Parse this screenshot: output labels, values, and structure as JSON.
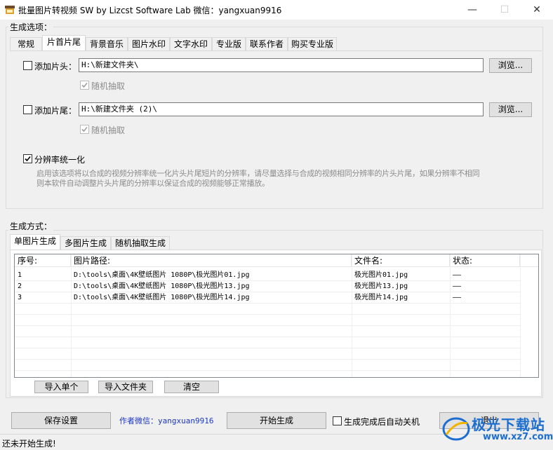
{
  "window": {
    "title": "批量图片转视频 SW  by Lizcst Software Lab  微信：yangxuan9916",
    "minimize": "—",
    "maximize": "☐",
    "close": "✕"
  },
  "options_group": {
    "legend": "生成选项：",
    "tabs": [
      "常规",
      "片首片尾",
      "背景音乐",
      "图片水印",
      "文字水印",
      "专业版",
      "联系作者",
      "购买专业版"
    ],
    "active_tab": 1,
    "head": {
      "label": "添加片头：",
      "path": "H:\\新建文件夹\\",
      "browse": "浏览...",
      "random_label": "随机抽取"
    },
    "tail": {
      "label": "添加片尾：",
      "path": "H:\\新建文件夹 (2)\\",
      "browse": "浏览...",
      "random_label": "随机抽取"
    },
    "unify": {
      "label": "分辨率统一化",
      "checked": true,
      "description_line1": "启用该选项将以合成的视频分辨率统一化片头片尾短片的分辨率，请尽量选择与合成的视频相同分辨率的片头片尾，如果分辨率不相同",
      "description_line2": "则本软件自动调整片头片尾的分辨率以保证合成的视频能够正常播放。"
    }
  },
  "mode_group": {
    "legend": "生成方式：",
    "tabs": [
      "单图片生成",
      "多图片生成",
      "随机抽取生成"
    ],
    "active_tab": 0,
    "columns": [
      "序号:",
      "图片路径:",
      "文件名:",
      "状态:"
    ],
    "rows": [
      {
        "index": "1",
        "path": "D:\\tools\\桌面\\4K壁纸图片 1080P\\极光图片01.jpg",
        "filename": "极光图片01.jpg",
        "status": "——"
      },
      {
        "index": "2",
        "path": "D:\\tools\\桌面\\4K壁纸图片 1080P\\极光图片13.jpg",
        "filename": "极光图片13.jpg",
        "status": "——"
      },
      {
        "index": "3",
        "path": "D:\\tools\\桌面\\4K壁纸图片 1080P\\极光图片14.jpg",
        "filename": "极光图片14.jpg",
        "status": "——"
      }
    ],
    "import_single": "导入单个",
    "import_folder": "导入文件夹",
    "clear": "清空"
  },
  "bottom": {
    "save_settings": "保存设置",
    "author_wechat": "作者微信：yangxuan9916",
    "start": "开始生成",
    "auto_shutdown": "生成完成后自动关机",
    "exit": "退出",
    "status": "还未开始生成!"
  },
  "watermark": {
    "brand": "极光下载站",
    "url": "www.xz7.com"
  },
  "colors": {
    "author_link": "#1a36c4",
    "watermark_blue": "#1c6fd1"
  }
}
